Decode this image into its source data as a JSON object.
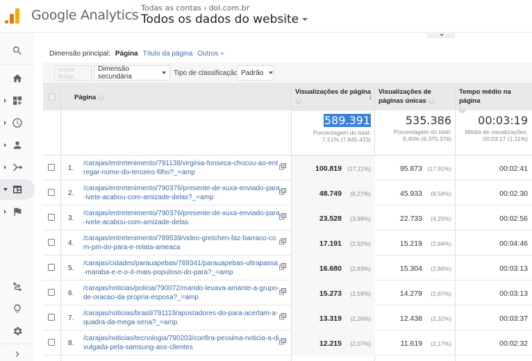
{
  "header": {
    "brand": "Google Analytics",
    "breadcrumb": {
      "account": "Todas as contas",
      "property": "dol.com.br"
    },
    "view_title": "Todos os dados do website"
  },
  "sidebar": {
    "items": [
      {
        "name": "search",
        "icon": "search-icon"
      },
      {
        "name": "home",
        "icon": "home-icon"
      },
      {
        "name": "customization",
        "icon": "dashboard-add-icon"
      },
      {
        "name": "realtime",
        "icon": "clock-icon"
      },
      {
        "name": "audience",
        "icon": "person-icon"
      },
      {
        "name": "acquisition",
        "icon": "acquisition-icon"
      },
      {
        "name": "behavior",
        "icon": "behavior-icon",
        "active": true
      },
      {
        "name": "conversions",
        "icon": "flag-icon"
      },
      {
        "name": "attribution",
        "icon": "attribution-icon"
      },
      {
        "name": "discover",
        "icon": "lightbulb-icon"
      },
      {
        "name": "admin",
        "icon": "gear-icon"
      },
      {
        "name": "expand",
        "icon": "chevron-right-icon"
      }
    ]
  },
  "dimensions": {
    "label": "Dimensão principal:",
    "current": "Página",
    "options": [
      "Título da página",
      "Outros"
    ]
  },
  "toolbar": {
    "insert_rows": "Inserir linhas",
    "secondary_dimension": "Dimensão secundária",
    "sort_type_label": "Tipo de classificação:",
    "sort_type_value": "Padrão"
  },
  "table": {
    "columns": {
      "page": "Página",
      "pageviews": "Visualizações de página",
      "unique_pageviews": "Visualizações de páginas únicas",
      "avg_time": "Tempo médio na página"
    },
    "totals": {
      "pageviews": "589.391",
      "pageviews_sub1": "Porcentagem do total:",
      "pageviews_sub2": "7,51% (7.845.433)",
      "unique": "535.386",
      "unique_sub1": "Porcentagem do total:",
      "unique_sub2": "8,40% (6.375.376)",
      "avg_time": "00:03:19",
      "avg_time_sub1": "Média de visualizações:",
      "avg_time_sub2": "00:03:17 (1,11%)"
    },
    "rows": [
      {
        "n": "1.",
        "url": "/carajas/entretenimento/791138/virginia-fonseca-chocou-ao-entregar-nome-do-terceiro-filho?_=amp",
        "pv": "100.819",
        "pv_pct": "(17,11%)",
        "upv": "95.873",
        "upv_pct": "(17,91%)",
        "time": "00:02:41"
      },
      {
        "n": "2.",
        "url": "/carajas/entretenimento/790376/presente-de-xuxa-enviado-para-ivete-acabou-com-amizade-delas?_=amp",
        "pv": "48.749",
        "pv_pct": "(8,27%)",
        "upv": "45.933",
        "upv_pct": "(8,58%)",
        "time": "00:02:30"
      },
      {
        "n": "3.",
        "url": "/carajas/entretenimento/790376/presente-de-xuxa-enviado-para-ivete-acabou-com-amizade-delas",
        "pv": "23.528",
        "pv_pct": "(3,99%)",
        "upv": "22.733",
        "upv_pct": "(4,25%)",
        "time": "00:02:56"
      },
      {
        "n": "4.",
        "url": "/carajas/entretenimento/789539/video-gretchen-faz-barraco-com-pm-do-para-e-relata-ameaca",
        "pv": "17.191",
        "pv_pct": "(2,92%)",
        "upv": "15.219",
        "upv_pct": "(2,84%)",
        "time": "00:04:46"
      },
      {
        "n": "5.",
        "url": "/carajas/cidades/parauapebas/789341/parauapebas-ultrapassa-maraba-e-e-o-4-mais-populoso-do-para?_=amp",
        "pv": "16.680",
        "pv_pct": "(2,83%)",
        "upv": "15.304",
        "upv_pct": "(2,86%)",
        "time": "00:03:13"
      },
      {
        "n": "6.",
        "url": "/carajas/noticias/policia/790072/marido-levava-amante-a-grupo-de-oracao-da-propria-esposa?_=amp",
        "pv": "15.273",
        "pv_pct": "(2,59%)",
        "upv": "14.279",
        "upv_pct": "(2,67%)",
        "time": "00:03:13"
      },
      {
        "n": "7.",
        "url": "/carajas/noticias/brasil/791119/apostadores-do-para-acertam-a-quadra-da-mega-sena?_=amp",
        "pv": "13.319",
        "pv_pct": "(2,26%)",
        "upv": "12.438",
        "upv_pct": "(2,32%)",
        "time": "00:03:37"
      },
      {
        "n": "8.",
        "url": "/carajas/noticias/tecnologia/790203/confira-pessima-noticia-a-divulgada-pela-samsung-aos-clientes",
        "pv": "12.215",
        "pv_pct": "(2,07%)",
        "upv": "11.619",
        "upv_pct": "(2,17%)",
        "time": "00:02:32"
      }
    ]
  },
  "colors": {
    "accent_orange": "#e8710a",
    "accent_yellow": "#f9ab00",
    "link": "#3c6ea8",
    "highlight": "#3b82d6"
  }
}
